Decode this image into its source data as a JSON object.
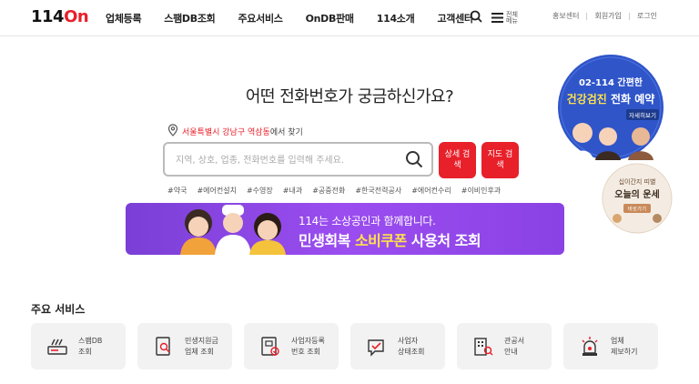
{
  "brand": {
    "logo_num": "114",
    "logo_on": "On",
    "accent": "#e8202a"
  },
  "nav": [
    "업체등록",
    "스팸DB조회",
    "주요서비스",
    "OnDB판매",
    "114소개",
    "고객센터"
  ],
  "header": {
    "menu_all": "전체 메뉴",
    "util": [
      "홍보센터",
      "회원가입",
      "로그인"
    ]
  },
  "hero": {
    "title": "어떤 전화번호가 궁금하신가요?",
    "location_prefix": "서울특별시 강남구 역삼동",
    "location_suffix": "에서 찾기",
    "search_placeholder": "지역, 상호, 업종, 전화번호를 입력해 주세요.",
    "btn_detail": "상세 검색",
    "btn_map": "지도 검색",
    "tags": [
      "#약국",
      "#에어컨설치",
      "#수영장",
      "#내과",
      "#공중전화",
      "#한국전력공사",
      "#에어컨수리",
      "#이비인후과"
    ]
  },
  "banner": {
    "line1": "114는 소상공인과 함께합니다.",
    "line2_a": "민생회복 ",
    "line2_b": "소비쿠폰",
    "line2_c": " 사용처 조회"
  },
  "badges": {
    "b1_top": "02-114 간편한",
    "b1_main_a": "건강검진",
    "b1_main_b": " 전화 예약",
    "b1_more": "자세히보기",
    "b2_top": "십이간지 띠별",
    "b2_main": "오늘의 운세",
    "b2_more": "바로가기"
  },
  "services": {
    "title": "주요 서비스",
    "items": [
      {
        "l1": "스팸DB",
        "l2": "조회",
        "icon": "spam-db-icon"
      },
      {
        "l1": "민생지원금",
        "l2": "업체 조회",
        "icon": "document-search-icon"
      },
      {
        "l1": "사업자등록",
        "l2": "번호 조회",
        "icon": "registration-icon"
      },
      {
        "l1": "사업자",
        "l2": "상태조회",
        "icon": "status-check-icon"
      },
      {
        "l1": "관공서",
        "l2": "안내",
        "icon": "building-icon"
      },
      {
        "l1": "업체",
        "l2": "제보하기",
        "icon": "report-siren-icon"
      }
    ]
  }
}
